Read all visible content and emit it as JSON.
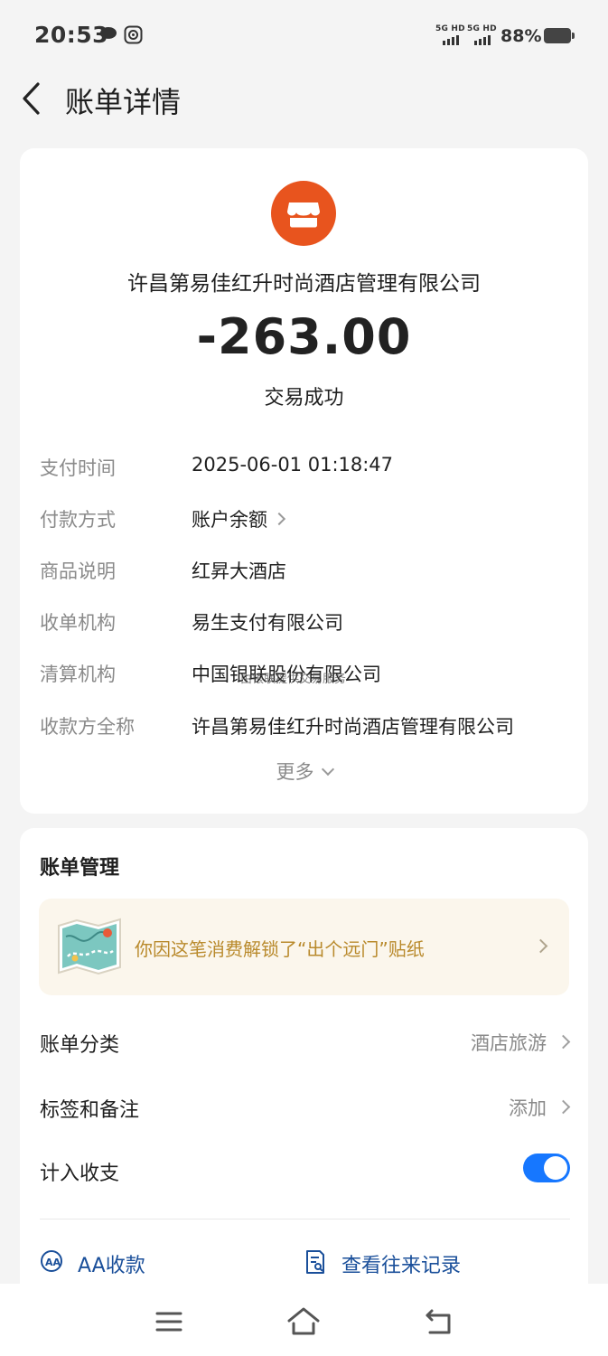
{
  "status_bar": {
    "time": "20:53",
    "sim1_label": "5G HD",
    "sim2_label": "5G HD",
    "battery": "88%",
    "icons": [
      "chat-bubble-icon",
      "shield-icon",
      "signal-icon",
      "battery-icon"
    ]
  },
  "header": {
    "title": "账单详情",
    "back_icon": "chevron-left-icon"
  },
  "transaction": {
    "merchant_icon": "store-icon",
    "merchant_color": "#e8541e",
    "merchant_name": "许昌第易佳红升时尚酒店管理有限公司",
    "amount": "-263.00",
    "status": "交易成功"
  },
  "details": [
    {
      "key": "支付时间",
      "value": "2025-06-01 01:18:47"
    },
    {
      "key": "付款方式",
      "value": "账户余额"
    },
    {
      "key": "商品说明",
      "value": "红昇大酒店"
    },
    {
      "key": "收单机构",
      "value": "易生支付有限公司"
    },
    {
      "key": "清算机构",
      "value": "中国银联股份有限公司"
    },
    {
      "key": "收款方全称",
      "value": "许昌第易佳红升时尚酒店管理有限公司"
    }
  ],
  "overlay_text": "由银联提供交易服务",
  "more_label": "更多",
  "manage": {
    "title": "账单管理",
    "sticker_text": "你因这笔消费解锁了“出个远门”贴纸",
    "category_label": "账单分类",
    "category_value": "酒店旅游",
    "tags_label": "标签和备注",
    "tags_value": "添加",
    "include_label": "计入收支",
    "include_enabled": true,
    "accent_color": "#1677ff",
    "aa_label": "AA收款",
    "records_label": "查看往来记录"
  },
  "navbar": {
    "icons": [
      "menu-icon",
      "home-icon",
      "back-icon"
    ]
  }
}
